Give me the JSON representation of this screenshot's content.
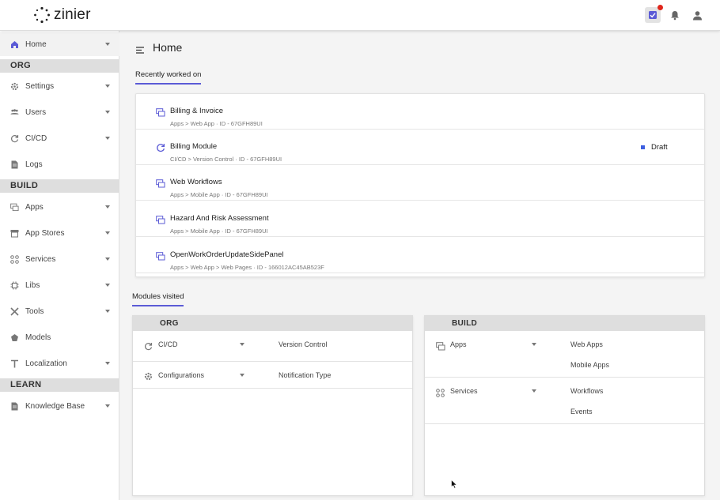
{
  "app": {
    "name": "zinier"
  },
  "header": {
    "icons": [
      "tasks-icon",
      "bell-icon",
      "user-icon"
    ],
    "notification_dot_color": "#e0261b"
  },
  "sidebar": {
    "items": [
      {
        "label": "Home",
        "icon": "home-icon",
        "has_caret": true,
        "active": true
      },
      {
        "section": "ORG"
      },
      {
        "label": "Settings",
        "icon": "gear-icon",
        "has_caret": true
      },
      {
        "label": "Users",
        "icon": "users-icon",
        "has_caret": true
      },
      {
        "label": "CI/CD",
        "icon": "refresh-icon",
        "has_caret": true
      },
      {
        "label": "Logs",
        "icon": "file-icon",
        "has_caret": false
      },
      {
        "section": "BUILD"
      },
      {
        "label": "Apps",
        "icon": "apps-icon",
        "has_caret": true
      },
      {
        "label": "App Stores",
        "icon": "store-icon",
        "has_caret": true
      },
      {
        "label": "Services",
        "icon": "services-icon",
        "has_caret": true
      },
      {
        "label": "Libs",
        "icon": "chip-icon",
        "has_caret": true
      },
      {
        "label": "Tools",
        "icon": "tools-icon",
        "has_caret": true
      },
      {
        "label": "Models",
        "icon": "pentagon-icon",
        "has_caret": false
      },
      {
        "label": "Localization",
        "icon": "text-icon",
        "has_caret": true
      },
      {
        "section": "LEARN"
      },
      {
        "label": "Knowledge Base",
        "icon": "book-icon",
        "has_caret": true
      }
    ]
  },
  "main": {
    "title": "Home",
    "recent_tab": "Recently worked on",
    "recent": [
      {
        "title": "Billing & Invoice",
        "path": "Apps > Web App · ID - 67GFH89UI",
        "icon": "app-icon"
      },
      {
        "title": "Billing Module",
        "path": "CI/CD > Version Control · ID - 67GFH89UI",
        "icon": "refresh-icon",
        "status": "Draft"
      },
      {
        "title": "Web Workflows",
        "path": "Apps > Mobile App · ID - 67GFH89UI",
        "icon": "app-icon"
      },
      {
        "title": "Hazard And Risk Assessment",
        "path": "Apps > Mobile App · ID - 67GFH89UI",
        "icon": "app-icon"
      },
      {
        "title": "OpenWorkOrderUpdateSidePanel",
        "path": "Apps > Web App > Web Pages · ID - 166012AC45AB523F",
        "icon": "app-icon"
      }
    ],
    "modules_tab": "Modules visited",
    "modules": {
      "org": {
        "title": "ORG",
        "rows": [
          {
            "label": "CI/CD",
            "icon": "refresh-icon",
            "subs": [
              "Version Control"
            ]
          },
          {
            "label": "Configurations",
            "icon": "gear-icon",
            "subs": [
              "Notification Type"
            ]
          }
        ]
      },
      "build": {
        "title": "BUILD",
        "rows": [
          {
            "label": "Apps",
            "icon": "apps-icon",
            "subs": [
              "Web Apps",
              "Mobile Apps"
            ]
          },
          {
            "label": "Services",
            "icon": "services-icon",
            "subs": [
              "Workflows",
              "Events"
            ]
          }
        ]
      }
    }
  },
  "colors": {
    "accent": "#5b5bd6",
    "draft": "#3d5fe0"
  }
}
